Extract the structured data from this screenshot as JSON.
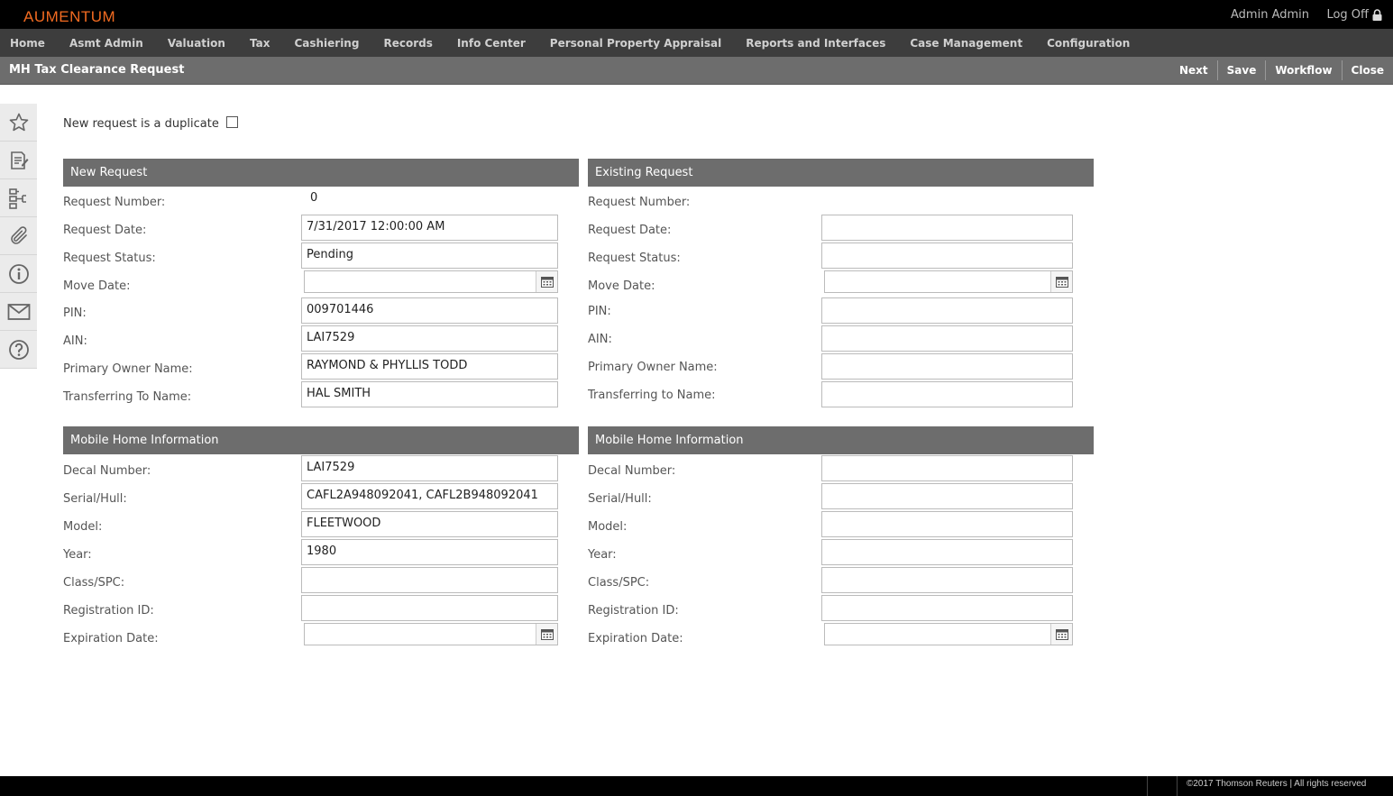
{
  "app": {
    "logo": "AUMENTUM",
    "user": "Admin Admin",
    "logoff": "Log Off"
  },
  "nav": [
    "Home",
    "Asmt Admin",
    "Valuation",
    "Tax",
    "Cashiering",
    "Records",
    "Info Center",
    "Personal Property Appraisal",
    "Reports and Interfaces",
    "Case Management",
    "Configuration"
  ],
  "page": {
    "title": "MH Tax Clearance Request"
  },
  "actions": {
    "next": "Next",
    "save": "Save",
    "workflow": "Workflow",
    "close": "Close"
  },
  "sidebar": [
    "star-icon",
    "document-edit-icon",
    "hierarchy-icon",
    "paperclip-icon",
    "info-icon",
    "envelope-icon",
    "help-icon"
  ],
  "duplicate": {
    "label": "New request is a duplicate",
    "checked": false
  },
  "new_request": {
    "header": "New Request",
    "labels": {
      "request_number": "Request Number:",
      "request_date": "Request Date:",
      "request_status": "Request Status:",
      "move_date": "Move Date:",
      "pin": "PIN:",
      "ain": "AIN:",
      "primary_owner": "Primary Owner Name:",
      "transferring_to": "Transferring To Name:"
    },
    "values": {
      "request_number": "0",
      "request_date": "7/31/2017 12:00:00 AM",
      "request_status": "Pending",
      "move_date": "",
      "pin": "009701446",
      "ain": "LAI7529",
      "primary_owner": "RAYMOND & PHYLLIS TODD",
      "transferring_to": "HAL SMITH"
    }
  },
  "existing_request": {
    "header": "Existing Request",
    "labels": {
      "request_number": "Request Number:",
      "request_date": "Request Date:",
      "request_status": "Request Status:",
      "move_date": "Move Date:",
      "pin": "PIN:",
      "ain": "AIN:",
      "primary_owner": "Primary Owner Name:",
      "transferring_to": "Transferring to Name:"
    },
    "values": {
      "request_number": "",
      "request_date": "",
      "request_status": "",
      "move_date": "",
      "pin": "",
      "ain": "",
      "primary_owner": "",
      "transferring_to": ""
    }
  },
  "new_mobile_home": {
    "header": "Mobile Home Information",
    "labels": {
      "decal": "Decal Number:",
      "serial": "Serial/Hull:",
      "model": "Model:",
      "year": "Year:",
      "class_spc": "Class/SPC:",
      "registration": "Registration ID:",
      "expiration": "Expiration Date:"
    },
    "values": {
      "decal": "LAI7529",
      "serial": "CAFL2A948092041, CAFL2B948092041",
      "model": "FLEETWOOD",
      "year": "1980",
      "class_spc": "",
      "registration": "",
      "expiration": ""
    }
  },
  "existing_mobile_home": {
    "header": "Mobile Home Information",
    "labels": {
      "decal": "Decal Number:",
      "serial": "Serial/Hull:",
      "model": "Model:",
      "year": "Year:",
      "class_spc": "Class/SPC:",
      "registration": "Registration ID:",
      "expiration": "Expiration Date:"
    },
    "values": {
      "decal": "",
      "serial": "",
      "model": "",
      "year": "",
      "class_spc": "",
      "registration": "",
      "expiration": ""
    }
  },
  "footer": {
    "copyright": "©2017 Thomson Reuters | All rights reserved"
  },
  "colors": {
    "brand": "#f26b21",
    "header_gray": "#6d6d6d",
    "nav_bg": "#3d3d3d"
  }
}
